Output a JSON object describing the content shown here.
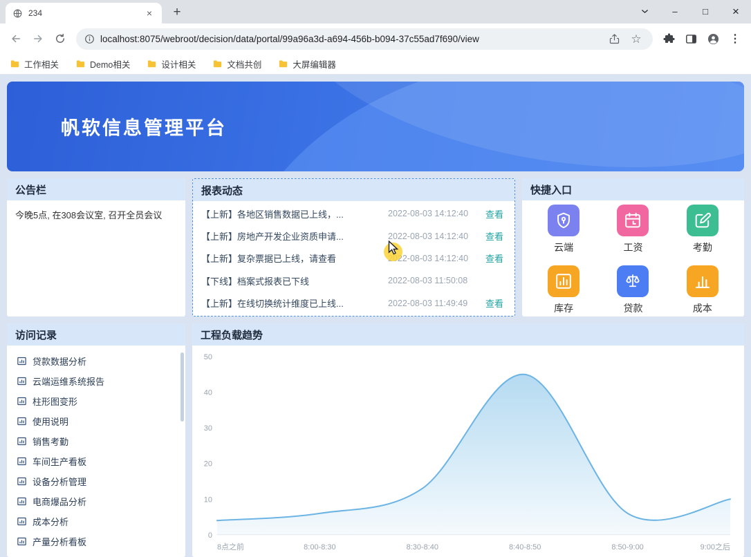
{
  "browser": {
    "tab_title": "234",
    "url": "localhost:8075/webroot/decision/data/portal/99a96a3d-a694-456b-b094-37c55ad7f690/view",
    "bookmarks": [
      "工作相关",
      "Demo相关",
      "设计相关",
      "文档共创",
      "大屏编辑器"
    ],
    "glyphs": {
      "new_tab": "+",
      "tab_close": "×",
      "minimize": "–",
      "maximize": "□",
      "close": "×",
      "star": "☆",
      "kebab": "⋮"
    }
  },
  "banner": {
    "title": "帆软信息管理平台"
  },
  "announcement": {
    "title": "公告栏",
    "content": "今晚5点, 在308会议室, 召开全员会议"
  },
  "news": {
    "title": "报表动态",
    "items": [
      {
        "text": "【上新】各地区销售数据已上线，...",
        "time": "2022-08-03 14:12:40",
        "view": "查看"
      },
      {
        "text": "【上新】房地产开发企业资质申请...",
        "time": "2022-08-03 14:12:40",
        "view": "查看"
      },
      {
        "text": "【上新】复杂票据已上线，请查看",
        "time": "2022-08-03 14:12:40",
        "view": "查看"
      },
      {
        "text": "【下线】档案式报表已下线",
        "time": "2022-08-03 11:50:08",
        "view": ""
      },
      {
        "text": "【上新】在线切换统计维度已上线...",
        "time": "2022-08-03 11:49:49",
        "view": "查看"
      }
    ]
  },
  "quick_entry": {
    "title": "快捷入口",
    "items": [
      {
        "label": "云端",
        "icon": "cloud-shield-icon",
        "color": "#7b82f0"
      },
      {
        "label": "工资",
        "icon": "salary-calendar-icon",
        "color": "#f1679f"
      },
      {
        "label": "考勤",
        "icon": "attendance-edit-icon",
        "color": "#3cbd92"
      },
      {
        "label": "库存",
        "icon": "inventory-chart-icon",
        "color": "#f6a623"
      },
      {
        "label": "贷款",
        "icon": "loan-scales-icon",
        "color": "#4d7df2"
      },
      {
        "label": "成本",
        "icon": "cost-chart-icon",
        "color": "#f6a623"
      }
    ]
  },
  "visits": {
    "title": "访问记录",
    "items": [
      "贷款数据分析",
      "云端运维系统报告",
      "柱形图变形",
      "使用说明",
      "销售考勤",
      "车间生产看板",
      "设备分析管理",
      "电商爆品分析",
      "成本分析",
      "产量分析看板"
    ]
  },
  "chart_data": {
    "type": "area",
    "title": "工程负载趋势",
    "categories": [
      "8点之前",
      "8:00-8:30",
      "8:30-8:40",
      "8:40-8:50",
      "8:50-9:00",
      "9:00之后"
    ],
    "values": [
      4,
      6,
      13,
      45,
      6,
      10
    ],
    "ylim": [
      0,
      50
    ],
    "yticks": [
      0,
      10,
      20,
      30,
      40,
      50
    ],
    "grid": false,
    "legend": false,
    "line_color": "#6cb4e4",
    "fill_color": "#a8d4ef"
  }
}
